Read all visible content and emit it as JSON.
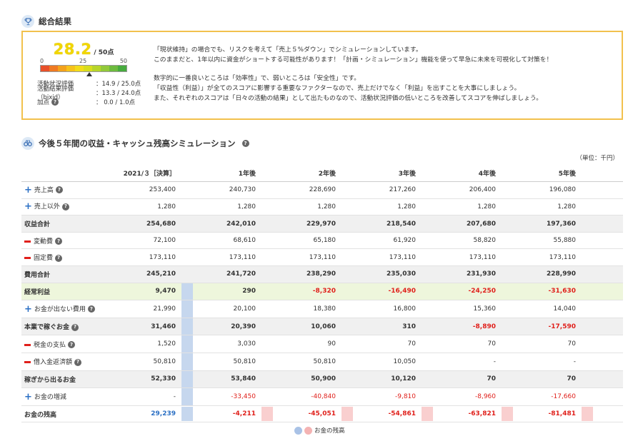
{
  "summary": {
    "title": "総合結果",
    "score": "28.2",
    "score_max": "/ 50点",
    "score_value": 28.2,
    "score_limit": 50,
    "scale": [
      "0",
      "25",
      "50"
    ],
    "scale_colors": [
      "#e8502a",
      "#ef7a23",
      "#f3a21c",
      "#f6c21a",
      "#f2dc1a",
      "#d7dd1d",
      "#b7d52a",
      "#92c93a",
      "#6dbb3f",
      "#47ab3e"
    ],
    "details": [
      {
        "label": "活動状況評価",
        "value": "：14.9 / 25.0点"
      },
      {
        "label": "活動結果評価（bixid）",
        "value": "：13.3 / 24.0点"
      },
      {
        "label": "加点",
        "value": "： 0.0 / 1.0点"
      }
    ],
    "message": [
      "「現状維持」の場合でも、リスクを考えて「売上５%ダウン」でシミュレーションしています。",
      "このままだと、1年以内に資金がショートする可能性があります！「計画・シミュレーション」機能を使って早急に未来を可視化して対策を！",
      "",
      "数字的に一番良いところは「効率性」で、弱いところは「安全性」です。",
      "「収益性（利益）」が全てのスコアに影響する重要なファクターなので、売上だけでなく「利益」を出すことを大事にしましょう。",
      "また、それぞれのスコアは「日々の活動の結果」として出たものなので、活動状況評価の低いところを改善してスコアを伸ばしましょう。"
    ]
  },
  "simulation": {
    "title": "今後５年間の収益・キャッシュ残高シミュレーション",
    "unit": "（単位：千円）",
    "columns": [
      "2021/３［決算］",
      "1年後",
      "2年後",
      "3年後",
      "4年後",
      "5年後"
    ],
    "rows": [
      {
        "label": "売上高",
        "icon": "plus",
        "help": true,
        "style": "",
        "values": [
          "253,400",
          "240,730",
          "228,690",
          "217,260",
          "206,400",
          "196,080"
        ]
      },
      {
        "label": "売上以外",
        "icon": "plus",
        "help": true,
        "style": "",
        "values": [
          "1,280",
          "1,280",
          "1,280",
          "1,280",
          "1,280",
          "1,280"
        ]
      },
      {
        "label": "収益合計",
        "icon": "",
        "help": false,
        "style": "gray bold",
        "values": [
          "254,680",
          "242,010",
          "229,970",
          "218,540",
          "207,680",
          "197,360"
        ]
      },
      {
        "label": "変動費",
        "icon": "minus",
        "help": true,
        "style": "",
        "values": [
          "72,100",
          "68,610",
          "65,180",
          "61,920",
          "58,820",
          "55,880"
        ]
      },
      {
        "label": "固定費",
        "icon": "minus",
        "help": true,
        "style": "",
        "values": [
          "173,110",
          "173,110",
          "173,110",
          "173,110",
          "173,110",
          "173,110"
        ]
      },
      {
        "label": "費用合計",
        "icon": "",
        "help": false,
        "style": "gray bold",
        "values": [
          "245,210",
          "241,720",
          "238,290",
          "235,030",
          "231,930",
          "228,990"
        ]
      },
      {
        "label": "経常利益",
        "icon": "",
        "help": false,
        "style": "green bold",
        "values": [
          "9,470",
          "290",
          "-8,320",
          "-16,490",
          "-24,250",
          "-31,630"
        ]
      },
      {
        "label": "お金が出ない費用",
        "icon": "plus",
        "help": true,
        "style": "",
        "values": [
          "21,990",
          "20,100",
          "18,380",
          "16,800",
          "15,360",
          "14,040"
        ]
      },
      {
        "label": "本業で稼ぐお金",
        "icon": "",
        "help": true,
        "style": "gray bold",
        "values": [
          "31,460",
          "20,390",
          "10,060",
          "310",
          "-8,890",
          "-17,590"
        ]
      },
      {
        "label": "税金の支払",
        "icon": "minus",
        "help": true,
        "style": "",
        "values": [
          "1,520",
          "3,030",
          "90",
          "70",
          "70",
          "70"
        ]
      },
      {
        "label": "借入金返済額",
        "icon": "minus",
        "help": true,
        "style": "",
        "values": [
          "50,810",
          "50,810",
          "50,810",
          "10,050",
          "-",
          "-"
        ]
      },
      {
        "label": "稼ぎから出るお金",
        "icon": "",
        "help": false,
        "style": "gray bold",
        "values": [
          "52,330",
          "53,840",
          "50,900",
          "10,120",
          "70",
          "70"
        ]
      },
      {
        "label": "お金の増減",
        "icon": "plus",
        "help": false,
        "style": "",
        "values": [
          "-",
          "-33,450",
          "-40,840",
          "-9,810",
          "-8,960",
          "-17,660"
        ]
      },
      {
        "label": "お金の残高",
        "icon": "",
        "help": false,
        "style": "bold balance",
        "values": [
          "29,239",
          "-4,211",
          "-45,051",
          "-54,861",
          "-63,821",
          "-81,481"
        ]
      }
    ]
  },
  "legend": {
    "label": "お金の残高",
    "colors": [
      "#a9c2e6",
      "#f4b3b3"
    ]
  }
}
